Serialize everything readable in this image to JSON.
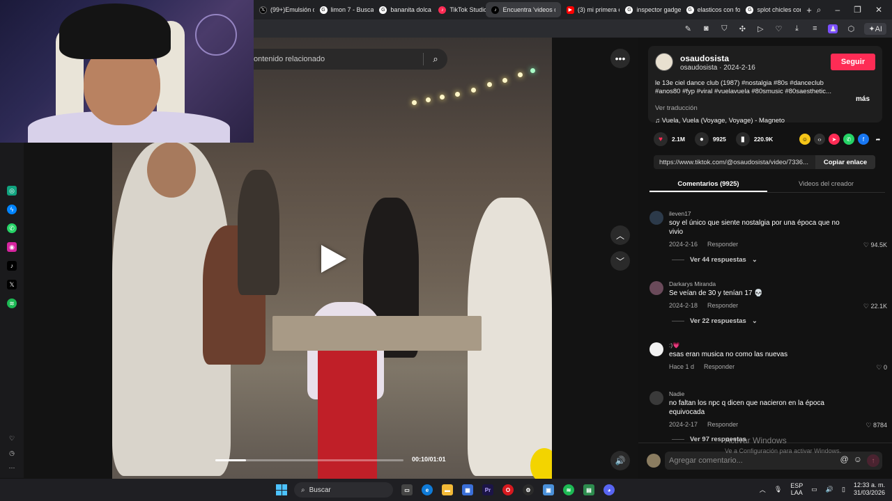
{
  "browser": {
    "tabs": [
      {
        "label": "(99+)Emulsión d",
        "icon": "x-logo-icon"
      },
      {
        "label": "limon 7 - Buscar",
        "icon": "google-icon"
      },
      {
        "label": "bananita dolca -",
        "icon": "google-icon"
      },
      {
        "label": "TikTok Studio",
        "icon": "tiktok-icon"
      },
      {
        "label": "Encuentra 'videos de nost",
        "icon": "tiktok-icon",
        "active": true
      },
      {
        "label": "(3) mi primera e",
        "icon": "youtube-icon"
      },
      {
        "label": "inspector gadget",
        "icon": "google-icon"
      },
      {
        "label": "elasticos con for",
        "icon": "google-icon"
      },
      {
        "label": "splot chicles con",
        "icon": "google-icon"
      }
    ],
    "new_tab": "+",
    "window_controls": [
      "search-icon",
      "minimize-icon",
      "restore-icon",
      "close-icon"
    ],
    "toolbar_ai": "AI"
  },
  "search": {
    "placeholder": "ontenido relacionado"
  },
  "video": {
    "time": "00:10/01:01",
    "progress": 0.164
  },
  "post": {
    "username": "osaudosista",
    "subline": "osaudosista · 2024-2-16",
    "follow": "Seguir",
    "description": "le 13e ciel dance club (1987) #nostalgia #80s #danceclub #anos80 #fyp #viral #vuelavuela #80smusic #80saesthetic...",
    "more": "más",
    "translate": "Ver traducción",
    "music": "Vuela, Vuela (Voyage, Voyage) - Magneto",
    "likes": "2.1M",
    "comments_count": "9925",
    "saves": "220.9K",
    "url": "https://www.tiktok.com/@osaudosista/video/7336...",
    "copy": "Copiar enlace",
    "share_icons": [
      "friends-icon",
      "embed-icon",
      "send-icon",
      "whatsapp-icon",
      "facebook-icon",
      "share-arrow-icon"
    ]
  },
  "panel_tabs": {
    "comments": "Comentarios (9925)",
    "creator": "Videos del creador"
  },
  "comments": [
    {
      "user": "ileven17",
      "text": "soy el único que siente nostalgia por una época que no vivio",
      "date": "2024-2-16",
      "reply": "Responder",
      "likes": "94.5K",
      "replies": "Ver 44 respuestas"
    },
    {
      "user": "Darkarys Miranda",
      "text": "Se veían de 30 y tenían 17 💀",
      "date": "2024-2-18",
      "reply": "Responder",
      "likes": "22.1K",
      "replies": "Ver 22 respuestas"
    },
    {
      "user": ":)💗",
      "text": "esas eran musica no como las nuevas",
      "date": "Hace 1 d",
      "reply": "Responder",
      "likes": "0"
    },
    {
      "user": "Nadie",
      "text": "no faltan los npc q dicen que nacieron en la época equivocada",
      "date": "2024-2-17",
      "reply": "Responder",
      "likes": "8784",
      "replies": "Ver 97 respuestas"
    }
  ],
  "comment_input": {
    "placeholder": "Agregar comentario..."
  },
  "watermark": {
    "line1": "Activar Windows",
    "line2": "Ve a Configuración para activar Windows."
  },
  "taskbar": {
    "search": "Buscar",
    "lang1": "ESP",
    "lang2": "LAA",
    "time": "12:33 a. m.",
    "date": "31/03/2026"
  }
}
